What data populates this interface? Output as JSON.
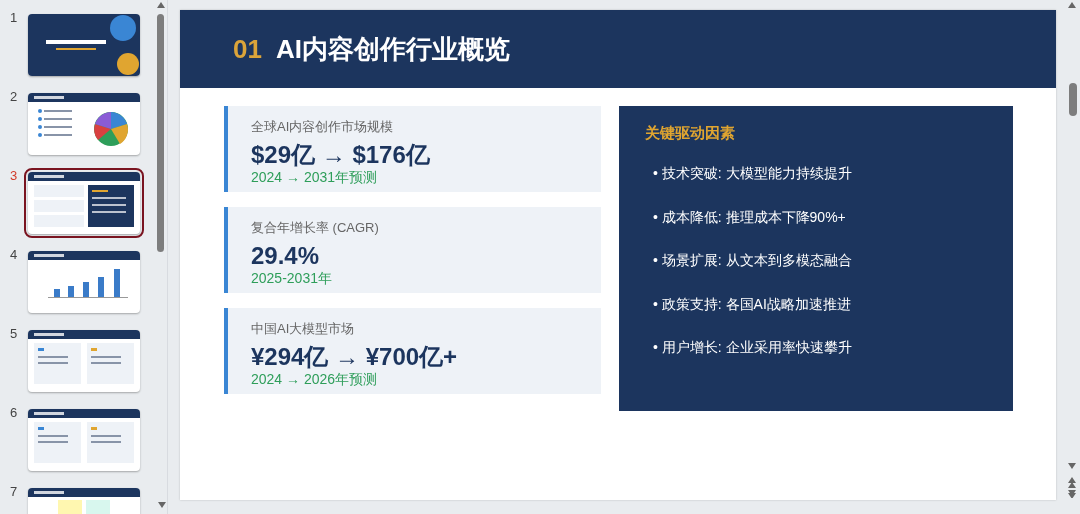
{
  "slides": [
    {
      "number": "1",
      "kind": "title",
      "selected": false
    },
    {
      "number": "2",
      "kind": "pie",
      "selected": false
    },
    {
      "number": "3",
      "kind": "overview",
      "selected": true
    },
    {
      "number": "4",
      "kind": "bar",
      "selected": false
    },
    {
      "number": "5",
      "kind": "cards",
      "selected": false
    },
    {
      "number": "6",
      "kind": "cards",
      "selected": false
    },
    {
      "number": "7",
      "kind": "table",
      "selected": false
    }
  ],
  "slide": {
    "number": "01",
    "title": "AI内容创作行业概览",
    "metrics": [
      {
        "label": "全球AI内容创作市场规模",
        "value": "$29亿 → $176亿",
        "note": "2024 → 2031年预测"
      },
      {
        "label": "复合年增长率 (CAGR)",
        "value": "29.4%",
        "note": "2025-2031年"
      },
      {
        "label": "中国AI大模型市场",
        "value": "¥294亿 → ¥700亿+",
        "note": "2024 → 2026年预测"
      }
    ],
    "drivers": {
      "title": "关键驱动因素",
      "items": [
        "• 技术突破: 大模型能力持续提升",
        "• 成本降低: 推理成本下降90%+",
        "• 场景扩展: 从文本到多模态融合",
        "• 政策支持: 各国AI战略加速推进",
        "• 用户增长: 企业采用率快速攀升"
      ]
    }
  }
}
